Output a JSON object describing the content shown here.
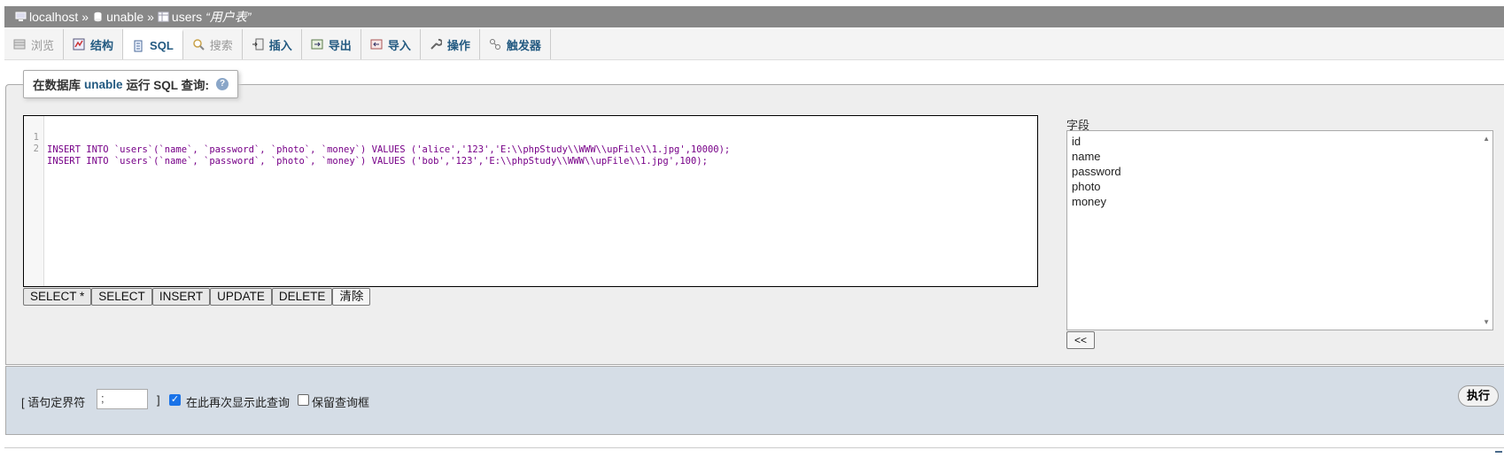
{
  "breadcrumb": {
    "server": "localhost",
    "database": "unable",
    "table": "users",
    "table_comment": "“用户表”",
    "separator": "»"
  },
  "tabs": [
    {
      "label": "浏览",
      "icon": "browse-icon",
      "state": "disabled"
    },
    {
      "label": "结构",
      "icon": "structure-icon",
      "state": "normal"
    },
    {
      "label": "SQL",
      "icon": "sql-icon",
      "state": "active"
    },
    {
      "label": "搜索",
      "icon": "search-icon",
      "state": "disabled"
    },
    {
      "label": "插入",
      "icon": "insert-icon",
      "state": "normal"
    },
    {
      "label": "导出",
      "icon": "export-icon",
      "state": "normal"
    },
    {
      "label": "导入",
      "icon": "import-icon",
      "state": "normal"
    },
    {
      "label": "操作",
      "icon": "wrench-icon",
      "state": "normal"
    },
    {
      "label": "触发器",
      "icon": "triggers-icon",
      "state": "normal"
    }
  ],
  "legend": {
    "prefix": "在数据库",
    "db": "unable",
    "suffix": "运行 SQL 查询:"
  },
  "editor": {
    "lines": [
      {
        "num": "1",
        "code": "INSERT INTO `users`(`name`, `password`, `photo`, `money`) VALUES ('alice','123','E:\\\\phpStudy\\\\WWW\\\\upFile\\\\1.jpg',10000);"
      },
      {
        "num": "2",
        "code": "INSERT INTO `users`(`name`, `password`, `photo`, `money`) VALUES ('bob','123','E:\\\\phpStudy\\\\WWW\\\\upFile\\\\1.jpg',100);"
      }
    ]
  },
  "snippets": [
    "SELECT *",
    "SELECT",
    "INSERT",
    "UPDATE",
    "DELETE",
    "清除"
  ],
  "fields": {
    "label": "字段",
    "options": [
      "id",
      "name",
      "password",
      "photo",
      "money"
    ],
    "insert_button": "<<"
  },
  "bottom": {
    "delimiter_label": "[ 语句定界符",
    "delimiter_value": ";",
    "delimiter_close": "]",
    "show_again_label": "在此再次显示此查询",
    "show_again_checked": true,
    "retain_box_label": "保留查询框",
    "retain_box_checked": false,
    "go_button": "执行"
  },
  "colors": {
    "header_bg": "#888888",
    "tab_link": "#235a81",
    "bottom_bg": "#d5dde6",
    "keyword": "#770088",
    "string": "#aa1111",
    "number": "#116644"
  }
}
